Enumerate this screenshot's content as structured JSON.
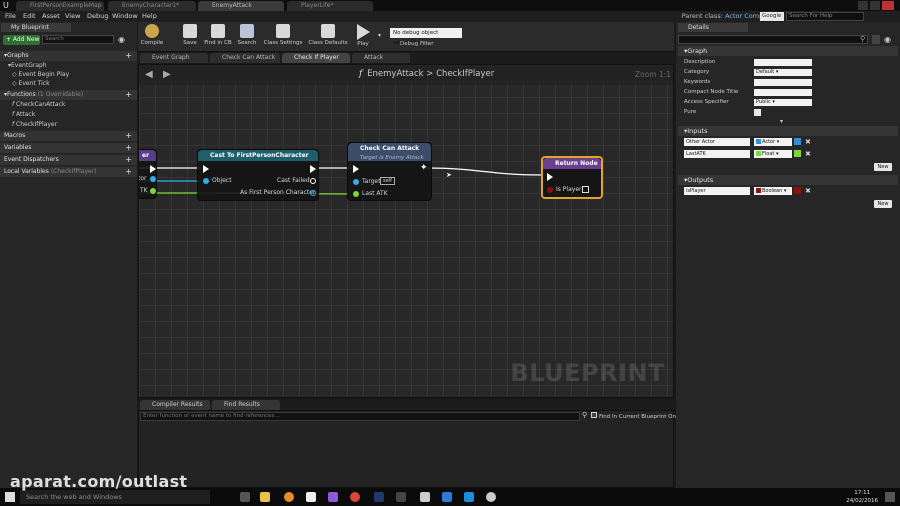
{
  "doc_tabs": [
    "FirstPersonExampleMap",
    "EnemyCharacter1*",
    "EnemyAttack",
    "PlayerLife*"
  ],
  "menu": [
    "File",
    "Edit",
    "Asset",
    "View",
    "Debug",
    "Window",
    "Help"
  ],
  "parent_class_label": "Parent class:",
  "parent_class_value": "Actor Component",
  "search_engine": "Google",
  "search_help_placeholder": "Search For Help",
  "toolbar": {
    "buttons": [
      "Compile",
      "Save",
      "Find in CB",
      "Search",
      "Class Settings",
      "Class Defaults",
      "Play"
    ],
    "debug_select": "No debug object selected",
    "debug_filter_label": "Debug Filter"
  },
  "left_panel": {
    "tab": "My Blueprint",
    "add_new": "+ Add New",
    "search_placeholder": "Search",
    "graphs_label": "Graphs",
    "event_graph": "EventGraph",
    "events": [
      "Event Begin Play",
      "Event Tick"
    ],
    "functions_label": "Functions",
    "functions_note": "(1 Overridable)",
    "functions": [
      "CheckCanAttack",
      "Attack",
      "CheckIfPlayer"
    ],
    "macros": "Macros",
    "variables": "Variables",
    "dispatchers": "Event Dispatchers",
    "locals": "Local Variables",
    "locals_note": "(CheckIfPlayer)"
  },
  "graph_tabs": [
    "Event Graph",
    "Check Can Attack",
    "Check If Player",
    "Attack"
  ],
  "graph": {
    "crumb_class": "EnemyAttack",
    "crumb_sep": ">",
    "crumb_func": "CheckIfPlayer",
    "zoom": "Zoom 1:1",
    "watermark": "BLUEPRINT",
    "node_partial_head": "er",
    "node_partial_pins": [
      "tor",
      "TK"
    ],
    "cast_node": {
      "title": "Cast To FirstPersonCharacter",
      "object": "Object",
      "cast_failed": "Cast Failed",
      "as": "As First Person Character"
    },
    "check_node": {
      "title": "Check Can Attack",
      "subtitle": "Target is Enemy Attack",
      "target": "Target",
      "self": "self",
      "last_atk": "Last ATK"
    },
    "return_node": {
      "title": "Return Node",
      "is_player": "Is Player"
    }
  },
  "bottom": {
    "tabs": [
      "Compiler Results",
      "Find Results"
    ],
    "find_placeholder": "Enter function or event name to find references...",
    "find_checkbox": "Find In Current Blueprint Only"
  },
  "details": {
    "tab": "Details",
    "graph_section": "Graph",
    "fields": [
      "Description",
      "Category",
      "Keywords",
      "Compact Node Title",
      "Access Specifier",
      "Pure"
    ],
    "category_value": "Default",
    "access_value": "Public",
    "inputs_section": "Inputs",
    "inputs": [
      {
        "name": "Other Actor",
        "type": "Actor",
        "color": "#2f8fd8"
      },
      {
        "name": "LastATK",
        "type": "Float",
        "color": "#7ad83a"
      }
    ],
    "outputs_section": "Outputs",
    "outputs": [
      {
        "name": "isPlayer",
        "type": "Boolean",
        "color": "#8b1010"
      }
    ],
    "new_label": "New"
  },
  "taskbar": {
    "search": "Search the web and Windows",
    "time": "17:11",
    "date": "24/02/2016"
  },
  "overlay_watermark": "aparat.com/outlast",
  "colors": {
    "cast_head": "#1f5f6b",
    "check_head": "#3c4d6a",
    "return_head": "#6b3f8f",
    "return_border": "#e0a52a",
    "float_pin": "#7ad83a",
    "object_pin": "#2fb0e6"
  }
}
